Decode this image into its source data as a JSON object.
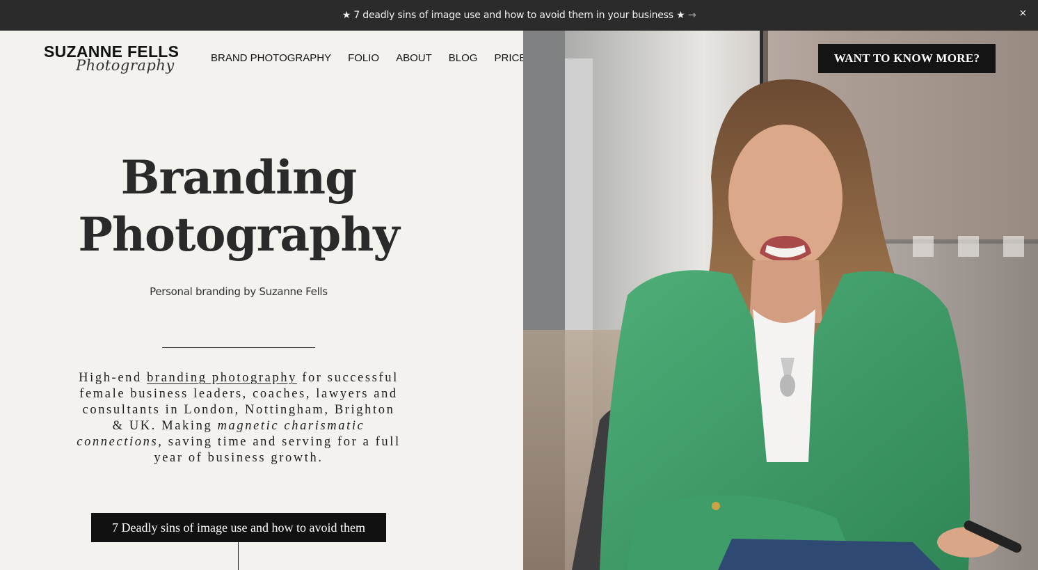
{
  "announcement": {
    "text": "★ 7 deadly sins of image use and how to avoid them in your business ★ ⇾",
    "close": "×"
  },
  "logo": {
    "line1": "SUZANNE FELLS",
    "line2": "Photography"
  },
  "nav": {
    "items": [
      {
        "label": "BRAND PHOTOGRAPHY"
      },
      {
        "label": "FOLIO"
      },
      {
        "label": "ABOUT"
      },
      {
        "label": "BLOG"
      },
      {
        "label": "PRICES"
      }
    ]
  },
  "header_cta": "WANT TO KNOW MORE?",
  "hero": {
    "title_line1": "Branding",
    "title_line2": "Photography",
    "subtitle": "Personal branding by Suzanne Fells",
    "body_pre": "High-end ",
    "body_link": "branding photography",
    "body_mid": " for successful female business leaders, coaches, lawyers and consultants in London, Nottingham, Brighton & UK. Making ",
    "body_em": "magnetic charismatic connections",
    "body_post": ", saving time and serving for a full year of business growth.",
    "cta": "7 Deadly sins of image use and how to avoid them"
  },
  "colors": {
    "announcement_bg": "#2b2b2b",
    "page_bg": "#f3f2ee",
    "button_bg": "#111111",
    "jacket_green": "#3f9d6a"
  }
}
